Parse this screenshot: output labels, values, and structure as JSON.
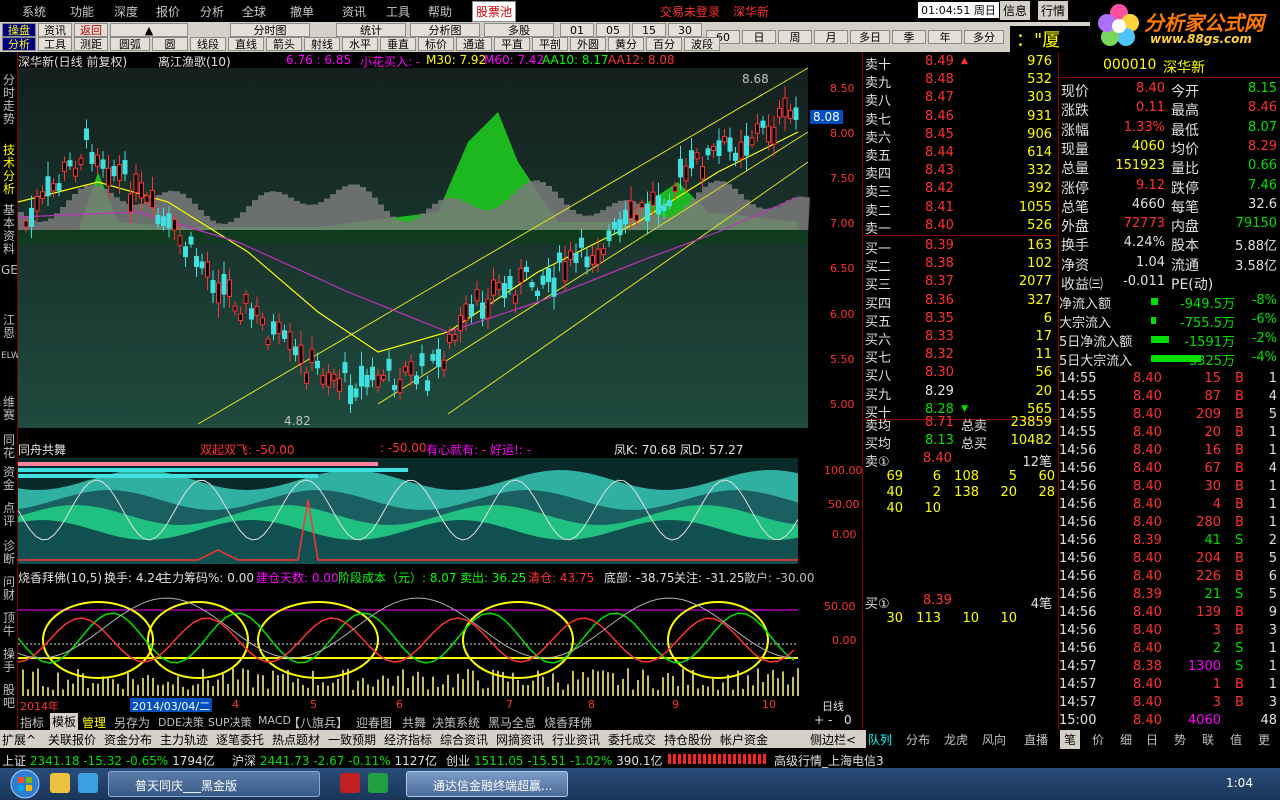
{
  "menu": [
    "系统",
    "功能",
    "深度",
    "报价",
    "分析",
    "全球",
    "撤单",
    "资讯",
    "工具",
    "帮助",
    "股票池"
  ],
  "login_status": "交易未登录",
  "login_broker": "深华新",
  "clock": "01:04:51 周日",
  "top_right_tabs": [
    "信息",
    "行情"
  ],
  "logo": {
    "title": "分析家公式网",
    "url": "www.88gs.com"
  },
  "toolbar_row1": [
    "操盘",
    "资讯",
    "返回",
    "▲",
    "分时图",
    "统计",
    "分析图",
    "多股",
    "01",
    "05",
    "15",
    "30",
    "60",
    "日",
    "周",
    "月",
    "多日",
    "季",
    "年",
    "多分"
  ],
  "toolbar_row2": [
    "分析",
    "工具",
    "测距",
    "圆弧",
    "圆",
    "线段",
    "直线",
    "箭头",
    "射线",
    "水平",
    "垂直",
    "标价",
    "通道",
    "平直",
    "平剖",
    "外圆",
    "黄分",
    "百分",
    "波段"
  ],
  "toolbar_ticker": "：\"厦",
  "side_tabs": [
    "分时走势",
    "技术分析",
    "基本资料",
    "GET",
    "江恩",
    "ELWAVE",
    "维赛",
    "同花",
    "资金",
    "点评",
    "诊断",
    "问财",
    "顶牛",
    "操手",
    "股吧"
  ],
  "chart1": {
    "header_name": "深华新(日线 前复权)",
    "header_indicator": "离江渔歌(10)",
    "header_vals": "6.76 : 6.85",
    "header_buy": "小花买入: -",
    "ma30": "M30: 7.92",
    "ma60": "M60: 7.42",
    "aa10": "AA10: 8.17",
    "aa12": "AA12: 8.08",
    "high_label": "8.68",
    "low_label": "4.82",
    "price_tag": "8.08",
    "y_ticks": [
      "8.50",
      "8.00",
      "7.50",
      "7.00",
      "6.50",
      "6.00",
      "5.50",
      "5.00"
    ]
  },
  "chart2": {
    "title": "同舟共舞",
    "sig1": "双起双飞: -50.00",
    "sig2": ": -50.00",
    "sig3": "有心就有: - 好运!: -",
    "kd": "凤K: 70.68 凤D: 57.27",
    "y_ticks": [
      "100.00",
      "50.00",
      "0.00"
    ]
  },
  "chart3": {
    "title": "烧香拜佛(10,5)",
    "turnover": "换手: 4.24",
    "main_chips": "主力筹码%: 0.00",
    "build_days": "建仓天数: 0.00",
    "stage_cost": "阶段成本（元）: 8.07",
    "sell_out": "卖出: 36.25",
    "clear": "清仓: 43.75",
    "bottom": "底部: -38.75",
    "watch": "关注: -31.25",
    "retail": "散户: -30.00",
    "y_ticks": [
      "50.00",
      "0.00"
    ]
  },
  "date_axis": {
    "year": "2014年",
    "cursor_date": "2014/03/04/二",
    "months": [
      "4",
      "5",
      "6",
      "7",
      "8",
      "9",
      "10"
    ],
    "period": "日线"
  },
  "bottom_tabs": [
    "指标",
    "模板",
    "管理",
    "另存为",
    "DDE决策",
    "SUP决策",
    "MACD",
    "【八旗兵】",
    "迎春图",
    "共舞",
    "决策系统",
    "黑马全息",
    "烧香拜佛"
  ],
  "zoom_btns": [
    "+",
    "-",
    "0"
  ],
  "function_bar": [
    "扩展^",
    "关联报价",
    "资金分布",
    "主力轨迹",
    "逐笔委托",
    "热点题材",
    "一致预期",
    "经济指标",
    "综合资讯",
    "网摘资讯",
    "行业资讯",
    "委托成交",
    "持仓股份",
    "帐户资金",
    "侧边栏<"
  ],
  "right_tabs": [
    "队列",
    "分布",
    "龙虎",
    "风向",
    "直播",
    "笔",
    "价",
    "细",
    "日",
    "势",
    "联",
    "值",
    "更"
  ],
  "order_book": {
    "asks": [
      {
        "label": "卖十",
        "price": "8.49",
        "vol": "976",
        "mark": "▲"
      },
      {
        "label": "卖九",
        "price": "8.48",
        "vol": "532",
        "mark": ""
      },
      {
        "label": "卖八",
        "price": "8.47",
        "vol": "303",
        "mark": ""
      },
      {
        "label": "卖七",
        "price": "8.46",
        "vol": "931",
        "mark": ""
      },
      {
        "label": "卖六",
        "price": "8.45",
        "vol": "906",
        "mark": ""
      },
      {
        "label": "卖五",
        "price": "8.44",
        "vol": "614",
        "mark": ""
      },
      {
        "label": "卖四",
        "price": "8.43",
        "vol": "332",
        "mark": ""
      },
      {
        "label": "卖三",
        "price": "8.42",
        "vol": "392",
        "mark": ""
      },
      {
        "label": "卖二",
        "price": "8.41",
        "vol": "1055",
        "mark": ""
      },
      {
        "label": "卖一",
        "price": "8.40",
        "vol": "526",
        "mark": ""
      }
    ],
    "bids": [
      {
        "label": "买一",
        "price": "8.39",
        "vol": "163",
        "mark": ""
      },
      {
        "label": "买二",
        "price": "8.38",
        "vol": "102",
        "mark": ""
      },
      {
        "label": "买三",
        "price": "8.37",
        "vol": "2077",
        "mark": ""
      },
      {
        "label": "买四",
        "price": "8.36",
        "vol": "327",
        "mark": ""
      },
      {
        "label": "买五",
        "price": "8.35",
        "vol": "6",
        "mark": ""
      },
      {
        "label": "买六",
        "price": "8.33",
        "vol": "17",
        "mark": ""
      },
      {
        "label": "买七",
        "price": "8.32",
        "vol": "11",
        "mark": ""
      },
      {
        "label": "买八",
        "price": "8.30",
        "vol": "56",
        "mark": ""
      },
      {
        "label": "买九",
        "price": "8.29",
        "vol": "20",
        "mark": ""
      },
      {
        "label": "买十",
        "price": "8.28",
        "vol": "565",
        "mark": "▼"
      }
    ],
    "ask_avg": {
      "label": "卖均",
      "price": "8.71",
      "tlabel": "总卖",
      "total": "23859"
    },
    "bid_avg": {
      "label": "买均",
      "price": "8.13",
      "tlabel": "总买",
      "total": "10482"
    },
    "ask1_queue": {
      "label": "卖①",
      "price": "8.40",
      "count": "12笔",
      "rows": [
        [
          "69",
          "6",
          "108",
          "5",
          "60"
        ],
        [
          "40",
          "2",
          "138",
          "20",
          "28"
        ],
        [
          "40",
          "10",
          "",
          "",
          ""
        ]
      ]
    },
    "bid1_queue": {
      "label": "买①",
      "price": "8.39",
      "count": "4笔",
      "rows": [
        [
          "30",
          "113",
          "10",
          "10",
          ""
        ]
      ]
    }
  },
  "quote": {
    "code": "000010",
    "name": "深华新",
    "rows": [
      {
        "l1": "现价",
        "v1": "8.40",
        "c1": "red",
        "l2": "今开",
        "v2": "8.15",
        "c2": "grn"
      },
      {
        "l1": "涨跌",
        "v1": "0.11",
        "c1": "red",
        "l2": "最高",
        "v2": "8.46",
        "c2": "red"
      },
      {
        "l1": "涨幅",
        "v1": "1.33%",
        "c1": "red",
        "l2": "最低",
        "v2": "8.07",
        "c2": "grn"
      },
      {
        "l1": "现量",
        "v1": "4060",
        "c1": "yel",
        "l2": "均价",
        "v2": "8.29",
        "c2": "red"
      },
      {
        "l1": "总量",
        "v1": "151923",
        "c1": "yel",
        "l2": "量比",
        "v2": "0.66",
        "c2": "grn"
      },
      {
        "l1": "涨停",
        "v1": "9.12",
        "c1": "red",
        "l2": "跌停",
        "v2": "7.46",
        "c2": "grn"
      },
      {
        "l1": "总笔",
        "v1": "4660",
        "c1": "wht",
        "l2": "每笔",
        "v2": "32.6",
        "c2": "wht"
      },
      {
        "l1": "外盘",
        "v1": "72773",
        "c1": "red",
        "l2": "内盘",
        "v2": "79150",
        "c2": "grn"
      },
      {
        "l1": "换手",
        "v1": "4.24%",
        "c1": "wht",
        "l2": "股本",
        "v2": "5.88亿",
        "c2": "wht"
      },
      {
        "l1": "净资",
        "v1": "1.04",
        "c1": "wht",
        "l2": "流通",
        "v2": "3.58亿",
        "c2": "wht"
      },
      {
        "l1": "收益㈢",
        "v1": "-0.011",
        "c1": "wht",
        "l2": "PE(动)",
        "v2": "",
        "c2": "wht"
      }
    ],
    "flows": [
      {
        "label": "净流入额",
        "value": "-949.5万",
        "pct": "-8%",
        "fill": 0.08
      },
      {
        "label": "大宗流入",
        "value": "-755.5万",
        "pct": "-6%",
        "fill": 0.06
      },
      {
        "label": "5日净流入额",
        "value": "-1591万",
        "pct": "-2%",
        "fill": 0.2
      },
      {
        "label": "5日大宗流入",
        "value": "-3325万",
        "pct": "-4%",
        "fill": 0.55
      }
    ],
    "ticks": [
      {
        "t": "14:55",
        "p": "8.40",
        "pc": "red",
        "v": "15",
        "vc": "red",
        "d": "B",
        "n": "1"
      },
      {
        "t": "14:55",
        "p": "8.40",
        "pc": "red",
        "v": "87",
        "vc": "red",
        "d": "B",
        "n": "4"
      },
      {
        "t": "14:55",
        "p": "8.40",
        "pc": "red",
        "v": "209",
        "vc": "red",
        "d": "B",
        "n": "5"
      },
      {
        "t": "14:55",
        "p": "8.40",
        "pc": "red",
        "v": "20",
        "vc": "red",
        "d": "B",
        "n": "1"
      },
      {
        "t": "14:56",
        "p": "8.40",
        "pc": "red",
        "v": "16",
        "vc": "red",
        "d": "B",
        "n": "1"
      },
      {
        "t": "14:56",
        "p": "8.40",
        "pc": "red",
        "v": "67",
        "vc": "red",
        "d": "B",
        "n": "4"
      },
      {
        "t": "14:56",
        "p": "8.40",
        "pc": "red",
        "v": "30",
        "vc": "red",
        "d": "B",
        "n": "1"
      },
      {
        "t": "14:56",
        "p": "8.40",
        "pc": "red",
        "v": "4",
        "vc": "red",
        "d": "B",
        "n": "1"
      },
      {
        "t": "14:56",
        "p": "8.40",
        "pc": "red",
        "v": "280",
        "vc": "red",
        "d": "B",
        "n": "1"
      },
      {
        "t": "14:56",
        "p": "8.39",
        "pc": "red",
        "v": "41",
        "vc": "grn",
        "d": "S",
        "n": "2"
      },
      {
        "t": "14:56",
        "p": "8.40",
        "pc": "red",
        "v": "204",
        "vc": "red",
        "d": "B",
        "n": "5"
      },
      {
        "t": "14:56",
        "p": "8.40",
        "pc": "red",
        "v": "226",
        "vc": "red",
        "d": "B",
        "n": "6"
      },
      {
        "t": "14:56",
        "p": "8.39",
        "pc": "red",
        "v": "21",
        "vc": "grn",
        "d": "S",
        "n": "5"
      },
      {
        "t": "14:56",
        "p": "8.40",
        "pc": "red",
        "v": "139",
        "vc": "red",
        "d": "B",
        "n": "9"
      },
      {
        "t": "14:56",
        "p": "8.40",
        "pc": "red",
        "v": "3",
        "vc": "red",
        "d": "B",
        "n": "3"
      },
      {
        "t": "14:56",
        "p": "8.40",
        "pc": "red",
        "v": "2",
        "vc": "grn",
        "d": "S",
        "n": "1"
      },
      {
        "t": "14:57",
        "p": "8.38",
        "pc": "red",
        "v": "1300",
        "vc": "mag",
        "d": "S",
        "n": "1"
      },
      {
        "t": "14:57",
        "p": "8.40",
        "pc": "red",
        "v": "1",
        "vc": "red",
        "d": "B",
        "n": "1"
      },
      {
        "t": "14:57",
        "p": "8.40",
        "pc": "red",
        "v": "3",
        "vc": "red",
        "d": "B",
        "n": "3"
      },
      {
        "t": "15:00",
        "p": "8.40",
        "pc": "red",
        "v": "4060",
        "vc": "mag",
        "d": "",
        "n": "48"
      }
    ]
  },
  "status": {
    "sh_label": "上证",
    "sh_val": "2341.18",
    "sh_chg": "-15.32",
    "sh_pct": "-0.65%",
    "sh_amt": "1794亿",
    "hs_label": "沪深",
    "hs_val": "2441.73",
    "hs_chg": "-2.67",
    "hs_pct": "-0.11%",
    "hs_amt": "1127亿",
    "cy_label": "创业",
    "cy_val": "1511.05",
    "cy_chg": "-15.51",
    "cy_pct": "-1.02%",
    "cy_amt": "390.1亿",
    "server": "高级行情_上海电信3"
  },
  "taskbar": {
    "item1": "普天同庆___黑金版",
    "item2": "通达信金融终端超赢...",
    "time": "1:04"
  }
}
